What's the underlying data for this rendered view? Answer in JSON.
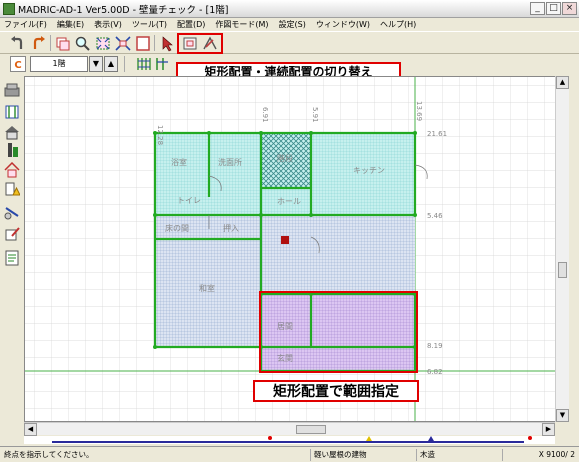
{
  "window": {
    "title": "MADRIC-AD-1 Ver5.00D - 壁量チェック - [1階]"
  },
  "window_buttons": {
    "minimize": "_",
    "maximize": "□",
    "close": "×"
  },
  "menu": [
    "ファイル(F)",
    "編集(E)",
    "表示(V)",
    "ツール(T)",
    "配置(D)",
    "作図モード(M)",
    "設定(S)",
    "ウィンドウ(W)",
    "ヘルプ(H)"
  ],
  "toolbar2": {
    "floor": "1階",
    "down": "▼",
    "up": "▲"
  },
  "callouts": {
    "top": "矩形配置・連続配置の切り替え",
    "bottom": "矩形配置で範囲指定"
  },
  "plan": {
    "top_dims": [
      "12.28",
      "6.91",
      "5.91",
      "13.69"
    ],
    "right_dims": [
      "21.61",
      "5.46",
      "8.19",
      "6.82"
    ],
    "rooms": [
      "浴室",
      "洗面所",
      "階段",
      "キッチン",
      "トイレ",
      "ホール",
      "床の間",
      "押入",
      "和室",
      "居間",
      "玄関"
    ]
  },
  "status": {
    "message": "終点を指示してください。",
    "building": "軽い屋根の建物",
    "structure": "木造",
    "scale": "X 9100/ 2"
  },
  "colors": {
    "accent_red": "#e00000",
    "cyan_area": "#bfeeee",
    "blue_area": "#c8d8ee",
    "purple_area": "#d8b8f0",
    "wall_green": "#22aa22"
  }
}
